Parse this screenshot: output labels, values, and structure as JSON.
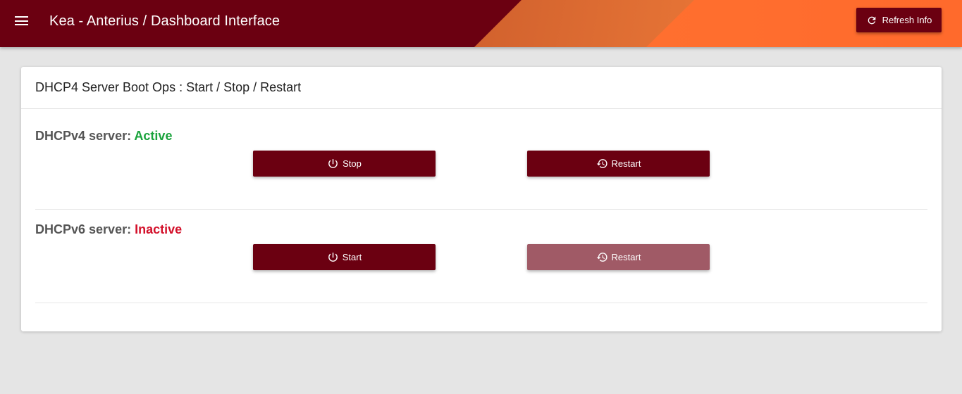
{
  "header": {
    "title": "Kea - Anterius / Dashboard Interface",
    "refresh_label": "Refresh Info",
    "menu_icon": "hamburger-menu-icon",
    "refresh_icon": "refresh-icon"
  },
  "card": {
    "title": "DHCP4 Server Boot Ops : Start / Stop / Restart"
  },
  "servers": [
    {
      "label": "DHCPv4 server:",
      "status": "Active",
      "primary_button": "Stop",
      "secondary_button": "Restart",
      "secondary_enabled": true
    },
    {
      "label": "DHCPv6 server:",
      "status": "Inactive",
      "primary_button": "Start",
      "secondary_button": "Restart",
      "secondary_enabled": false
    }
  ],
  "colors": {
    "brand": "#6b0011",
    "active": "#1aa33c",
    "inactive": "#d3102a",
    "disabled_button": "#a05a66"
  }
}
